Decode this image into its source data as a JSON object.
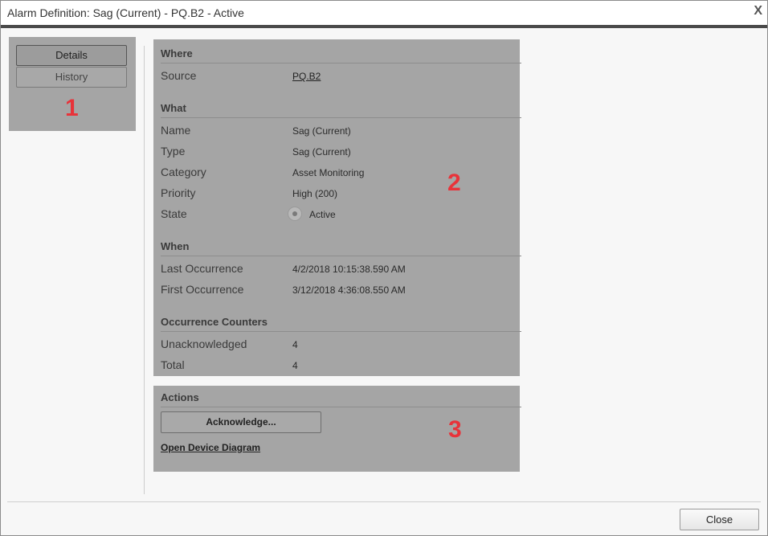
{
  "window": {
    "title": "Alarm Definition: Sag (Current) - PQ.B2 - Active",
    "close_glyph": "X"
  },
  "tabs": [
    {
      "label": "Details",
      "active": true
    },
    {
      "label": "History",
      "active": false
    }
  ],
  "markers": {
    "one": "1",
    "two": "2",
    "three": "3"
  },
  "sections": {
    "where": {
      "heading": "Where",
      "source_label": "Source",
      "source_value": "PQ.B2"
    },
    "what": {
      "heading": "What",
      "name_label": "Name",
      "name_value": "Sag (Current)",
      "type_label": "Type",
      "type_value": "Sag (Current)",
      "category_label": "Category",
      "category_value": "Asset Monitoring",
      "priority_label": "Priority",
      "priority_value": "High (200)",
      "state_label": "State",
      "state_value": "Active"
    },
    "when": {
      "heading": "When",
      "last_label": "Last Occurrence",
      "last_value": "4/2/2018 10:15:38.590 AM",
      "first_label": "First Occurrence",
      "first_value": "3/12/2018 4:36:08.550 AM"
    },
    "counters": {
      "heading": "Occurrence Counters",
      "unack_label": "Unacknowledged",
      "unack_value": "4",
      "total_label": "Total",
      "total_value": "4"
    },
    "actions": {
      "heading": "Actions",
      "acknowledge_label": "Acknowledge...",
      "device_diagram_label": "Open Device Diagram"
    }
  },
  "footer": {
    "close_label": "Close"
  },
  "colors": {
    "marker": "#e8333a",
    "panel": "#a5a5a5",
    "titlebar_border": "#4a4a4a"
  }
}
